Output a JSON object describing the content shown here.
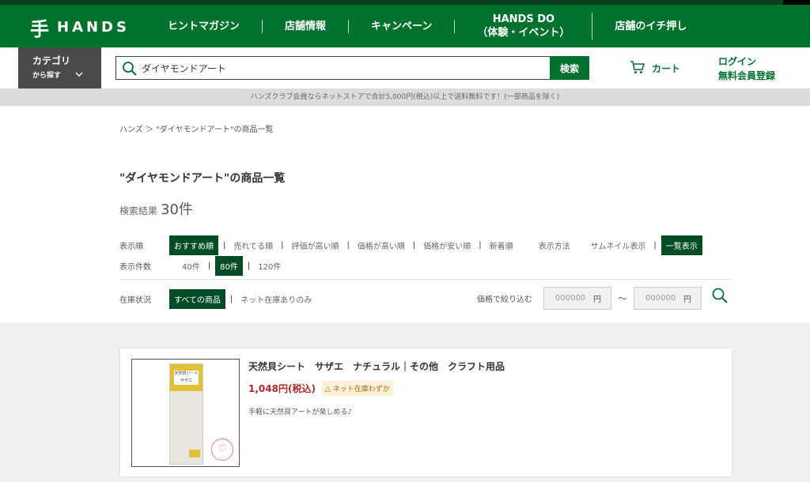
{
  "header": {
    "logo_mark": "手",
    "logo_text": "HANDS",
    "nav": [
      {
        "line1": "ヒントマガジン",
        "line2": ""
      },
      {
        "line1": "店舗情報",
        "line2": ""
      },
      {
        "line1": "キャンペーン",
        "line2": ""
      },
      {
        "line1": "HANDS DO",
        "line2": "（体験・イベント）"
      },
      {
        "line1": "店舗のイチ押し",
        "line2": ""
      }
    ]
  },
  "search": {
    "category_line1": "カテゴリ",
    "category_line2": "から探す",
    "query": "ダイヤモンドアート",
    "button": "検索",
    "cart": "カート",
    "login": "ログイン",
    "register": "無料会員登録"
  },
  "notice": "ハンズクラブ会員ならネットストアで合計5,000円(税込)以上で送料無料です！(一部商品を除く)",
  "breadcrumb": "ハンズ ＞ \"ダイヤモンドアート\"の商品一覧",
  "page_title": "\"ダイヤモンドアート\"の商品一覧",
  "results": {
    "label": "検索結果",
    "count": "30件"
  },
  "sort": {
    "label": "表示順",
    "options": [
      "おすすめ順",
      "売れてる順",
      "評価が高い順",
      "価格が高い順",
      "価格が安い順",
      "新着順"
    ],
    "selected": "おすすめ順"
  },
  "display": {
    "label": "表示方法",
    "options": [
      "サムネイル表示",
      "一覧表示"
    ],
    "selected": "一覧表示"
  },
  "per_page": {
    "label": "表示件数",
    "options": [
      "40件",
      "80件",
      "120件"
    ],
    "selected": "80件"
  },
  "stock": {
    "label": "在庫状況",
    "options": [
      "すべての商品",
      "ネット在庫ありのみ"
    ],
    "selected": "すべての商品"
  },
  "price_filter": {
    "label": "価格で絞り込む",
    "min_placeholder": "000000",
    "max_placeholder": "000000",
    "unit": "円",
    "tilde": "〜"
  },
  "product": {
    "title": "天然貝シート　サザエ　ナチュラル｜その他　クラフト用品",
    "price": "1,048円(税込)",
    "stock": "△ ネット在庫わずか",
    "description": "手軽に天然貝アートが楽しめる♪",
    "package_label": "天然貝シート サザエ"
  },
  "colors": {
    "brand_green": "#00722e",
    "dark_green": "#004d25",
    "price_red": "#b0282a"
  }
}
